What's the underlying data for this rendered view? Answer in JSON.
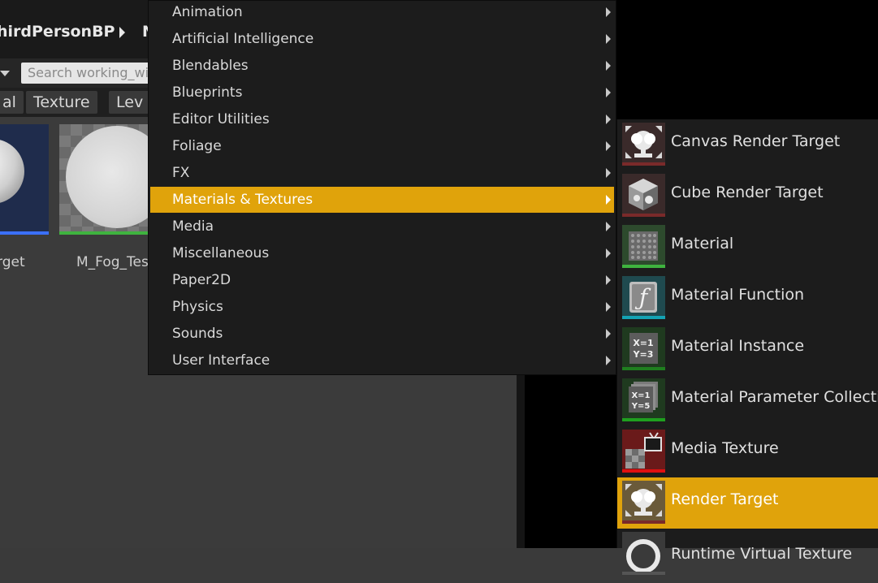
{
  "content_browser": {
    "breadcrumb": [
      "hirdPersonBP",
      "N"
    ],
    "search_placeholder": "Search working_wi",
    "filters": [
      "al",
      "Texture",
      "Lev"
    ],
    "assets": [
      {
        "label": "rget",
        "bar_color": "#3b70ff"
      },
      {
        "label": "M_Fog_Tes",
        "bar_color": "#3fb33f"
      }
    ]
  },
  "menu": {
    "items": [
      {
        "label": "Animation"
      },
      {
        "label": "Artificial Intelligence"
      },
      {
        "label": "Blendables"
      },
      {
        "label": "Blueprints"
      },
      {
        "label": "Editor Utilities"
      },
      {
        "label": "Foliage"
      },
      {
        "label": "FX"
      },
      {
        "label": "Materials & Textures",
        "active": true
      },
      {
        "label": "Media"
      },
      {
        "label": "Miscellaneous"
      },
      {
        "label": "Paper2D"
      },
      {
        "label": "Physics"
      },
      {
        "label": "Sounds"
      },
      {
        "label": "User Interface"
      }
    ]
  },
  "submenu": {
    "items": [
      {
        "label": "Canvas Render Target",
        "icon": "render-target-icon",
        "bar_color": "#7a2a2a"
      },
      {
        "label": "Cube Render Target",
        "icon": "cube-render-target-icon",
        "bar_color": "#7a2a2a"
      },
      {
        "label": "Material",
        "icon": "material-icon",
        "bar_color": "#3fb33f"
      },
      {
        "label": "Material Function",
        "icon": "material-function-icon",
        "bar_color": "#14a3b4"
      },
      {
        "label": "Material Instance",
        "icon": "material-instance-icon",
        "bar_color": "#1f7f1f"
      },
      {
        "label": "Material Parameter Collection",
        "icon": "material-parameter-collection-icon",
        "bar_color": "#1f9f1f"
      },
      {
        "label": "Media Texture",
        "icon": "media-texture-icon",
        "bar_color": "#e01010"
      },
      {
        "label": "Render Target",
        "icon": "render-target-icon",
        "bar_color": "#7a2a2a",
        "active": true
      },
      {
        "label": "Runtime Virtual Texture",
        "icon": "runtime-virtual-texture-icon",
        "bar_color": "#555555"
      }
    ]
  },
  "colors": {
    "accent": "#e0a30b",
    "menu_bg": "#1c1c1c",
    "viewport_bg": "#000000"
  },
  "fx_glyphs": {
    "function": "ƒ",
    "mi_line1": "X=1",
    "mi_line2": "Y=3",
    "mpc_line1": "X=1",
    "mpc_line2": "Y=5"
  }
}
